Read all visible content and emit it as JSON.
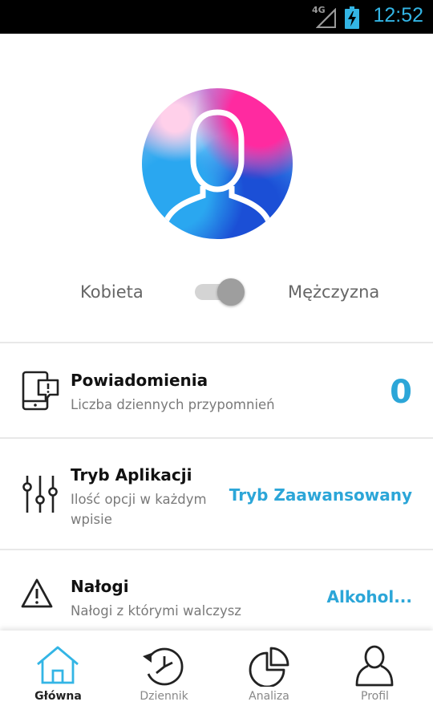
{
  "status_bar": {
    "network": "4G",
    "time": "12:52"
  },
  "profile": {
    "gender_female": "Kobieta",
    "gender_male": "Mężczyzna",
    "gender_toggle_on": true
  },
  "settings": [
    {
      "icon": "phone-notification-icon",
      "title": "Powiadomienia",
      "subtitle": "Liczba dziennych przypomnień",
      "value": "0"
    },
    {
      "icon": "sliders-icon",
      "title": "Tryb Aplikacji",
      "subtitle": "Ilość opcji w każdym wpisie",
      "value": "Tryb Zaawansowany"
    },
    {
      "icon": "warning-icon",
      "title": "Nałogi",
      "subtitle": "Nałogi z którymi walczysz",
      "value": "Alkohol..."
    }
  ],
  "bottom_nav": {
    "active": "Główna",
    "items": [
      {
        "label": "Główna",
        "icon": "home-icon"
      },
      {
        "label": "Dziennik",
        "icon": "history-clock-icon"
      },
      {
        "label": "Analiza",
        "icon": "pie-chart-icon"
      },
      {
        "label": "Profil",
        "icon": "user-icon"
      }
    ]
  },
  "colors": {
    "accent": "#2ca6d8",
    "status_time": "#33b5e5",
    "text_secondary": "#7a7a7a"
  }
}
